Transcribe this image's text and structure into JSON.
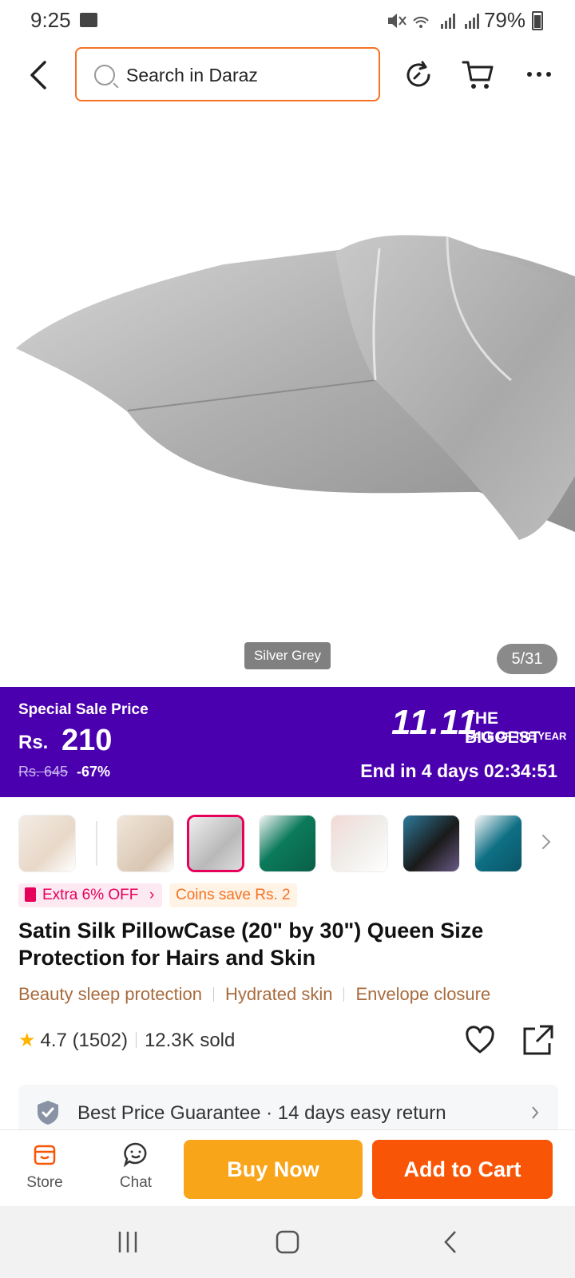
{
  "status_bar": {
    "time": "9:25",
    "battery": "79%",
    "icons": [
      "mute-icon",
      "wifi-icon",
      "signal-icon",
      "signal-icon"
    ]
  },
  "top_bar": {
    "search_placeholder": "Search in Daraz",
    "icons": [
      "back-icon",
      "search-icon",
      "refresh-icon",
      "cart-icon",
      "more-icon"
    ]
  },
  "gallery": {
    "variant_label": "Silver Grey",
    "counter": "5/31",
    "selected_index": 2
  },
  "sale_banner": {
    "label": "Special Sale Price",
    "currency": "Rs.",
    "price": "210",
    "old_price": "Rs. 645",
    "discount": "-67%",
    "event_number": "11.11",
    "event_line1": "THE BIGGEST",
    "event_line2": "SALE OF THE YEAR",
    "countdown": "End in 4 days 02:34:51",
    "colors": {
      "background": "#4b00af"
    }
  },
  "thumbnails": [
    {
      "color": "#e8d8c8"
    },
    {
      "color": "#e2d3c0"
    },
    {
      "color": "#b9b9b9"
    },
    {
      "color": "#0b7a5b"
    },
    {
      "color": "#f0ede9"
    },
    {
      "color": "#1a1a1a"
    },
    {
      "color": "#0e6f85"
    }
  ],
  "promo": {
    "extra": "Extra 6% OFF",
    "coins": "Coins save Rs. 2"
  },
  "product": {
    "title": "Satin Silk PillowCase (20\" by 30\") Queen Size Protection for Hairs and Skin",
    "features": [
      "Beauty sleep protection",
      "Hydrated skin",
      "Envelope closure"
    ],
    "rating": "4.7",
    "reviews": "(1502)",
    "sold": "12.3K sold"
  },
  "guarantee": {
    "text": "Best Price Guarantee · 14 days easy return"
  },
  "actions": {
    "store": "Store",
    "chat": "Chat",
    "buy_now": "Buy Now",
    "add_to_cart": "Add to Cart"
  },
  "colors": {
    "accent_orange": "#f57224",
    "buy_now": "#f9a51a",
    "add_to_cart": "#f85606"
  }
}
